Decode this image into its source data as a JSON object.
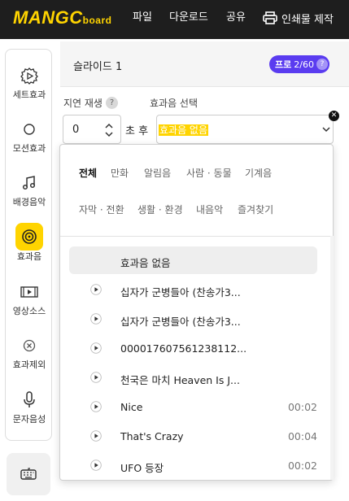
{
  "header": {
    "logo_main": "MANGC",
    "logo_sub": "board",
    "nav": [
      "파일",
      "다운로드",
      "공유"
    ],
    "print_label": "인쇄물 제작"
  },
  "sidebar": {
    "items": [
      {
        "label": "세트효과",
        "icon": "set-effect-icon"
      },
      {
        "label": "모션효과",
        "icon": "motion-effect-icon"
      },
      {
        "label": "배경음악",
        "icon": "music-note-icon"
      },
      {
        "label": "효과음",
        "icon": "sound-effect-icon",
        "active": true
      },
      {
        "label": "영상소스",
        "icon": "video-source-icon"
      },
      {
        "label": "효과제외",
        "icon": "exclude-effect-icon"
      },
      {
        "label": "문자음성",
        "icon": "microphone-icon"
      }
    ],
    "bottom_icon": "keyboard-icon"
  },
  "panel": {
    "slide_title": "슬라이드 1",
    "pro_label": "프로",
    "pro_count": "2/60",
    "pro_help": "?",
    "delay_label": "지연 재생",
    "delay_help": "?",
    "delay_value": "0",
    "delay_unit": "초 후",
    "sound_select_label": "효과음 선택",
    "sound_selected": "효과음 없음"
  },
  "dropdown": {
    "categories_row1": [
      "전체",
      "만화",
      "알림음",
      "사람 · 동물",
      "기계음"
    ],
    "categories_row2": [
      "자막 · 전환",
      "생활 · 환경",
      "내음악",
      "즐겨찾기"
    ],
    "active_category": "전체",
    "items": [
      {
        "name": "효과음 없음",
        "duration": "",
        "selected": true,
        "play": false
      },
      {
        "name": "십자가 군병들아 (찬송가3...",
        "duration": "",
        "play": true
      },
      {
        "name": "십자가 군병들아 (찬송가3...",
        "duration": "",
        "play": true
      },
      {
        "name": "000017607561238112...",
        "duration": "",
        "play": true
      },
      {
        "name": "천국은 마치 Heaven Is J...",
        "duration": "",
        "play": true
      },
      {
        "name": "Nice",
        "duration": "00:02",
        "play": true
      },
      {
        "name": "That's Crazy",
        "duration": "00:04",
        "play": true
      },
      {
        "name": "UFO 등장",
        "duration": "00:02",
        "play": true
      }
    ]
  },
  "colors": {
    "topbar": "#1e1e1e",
    "brand_yellow": "#ffd400",
    "pro_purple": "#5a3cf0"
  }
}
